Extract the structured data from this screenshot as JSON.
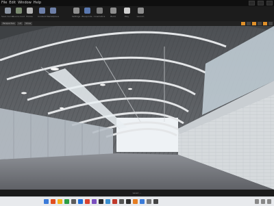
{
  "menu": {
    "items": [
      "File",
      "Edit",
      "Window",
      "Help"
    ]
  },
  "toolbar": {
    "items": [
      {
        "label": "Save Current",
        "icon": "save-icon",
        "color": "#8b95a3"
      },
      {
        "label": "Source Control",
        "icon": "source-control-icon",
        "color": "#7a8a70"
      },
      {
        "label": "Modes",
        "icon": "modes-icon",
        "color": "#b3b3b3"
      },
      {
        "label": "Content",
        "icon": "content-icon",
        "color": "#6d7fa8"
      },
      {
        "label": "Marketplace",
        "icon": "marketplace-icon",
        "color": "#6d7fa8"
      },
      {
        "label": "Settings",
        "icon": "gear-icon",
        "color": "#8f8f8f"
      },
      {
        "label": "Blueprints",
        "icon": "blueprint-icon",
        "color": "#5a78b0"
      },
      {
        "label": "Cinematics",
        "icon": "cinematics-icon",
        "color": "#7d7d7d"
      },
      {
        "label": "Build",
        "icon": "build-icon",
        "color": "#8e8e8e"
      },
      {
        "label": "Play",
        "icon": "play-icon",
        "color": "#d0d0d0"
      },
      {
        "label": "Launch",
        "icon": "launch-icon",
        "color": "#8e8e8e"
      }
    ]
  },
  "viewport": {
    "buttons": [
      "Perspective",
      "Lit",
      "Show"
    ],
    "scene": "warehouse-interior",
    "colors": {
      "sky": "#eef2f5",
      "floor": "#6f7176",
      "wall": "#d4d9dc",
      "roof": "#5b5e62"
    }
  },
  "statusbar": {
    "text": "Level: ..."
  },
  "taskbar": {
    "icons": [
      "#3b7bd8",
      "#e04e1f",
      "#f2b21b",
      "#2c9f45",
      "#5c5c5c",
      "#1e6fd9",
      "#d9442f",
      "#7a4fbf",
      "#2b2b2b",
      "#3a8fd0",
      "#c0392b",
      "#555",
      "#2f2f2f",
      "#e67e22",
      "#3b7bd8",
      "#777",
      "#444"
    ]
  }
}
